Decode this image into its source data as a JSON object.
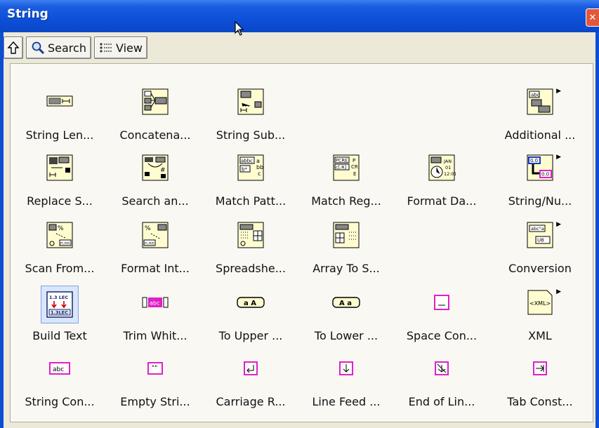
{
  "window": {
    "title": "String",
    "close_glyph": "✕"
  },
  "toolbar": {
    "up_icon": "up-arrow-icon",
    "search_label": "Search",
    "view_label": "View"
  },
  "palette": {
    "items": [
      {
        "label": "String Len...",
        "icon": "string-length-icon",
        "submenu": false
      },
      {
        "label": "Concatena...",
        "icon": "concatenate-icon",
        "submenu": false
      },
      {
        "label": "String Sub...",
        "icon": "string-subset-icon",
        "submenu": false
      },
      {
        "label": "Additional ...",
        "icon": "additional-functions-icon",
        "submenu": true
      },
      {
        "label": "Replace S...",
        "icon": "replace-substring-icon",
        "submenu": false
      },
      {
        "label": "Search an...",
        "icon": "search-and-replace-icon",
        "submenu": false
      },
      {
        "label": "Match Patt...",
        "icon": "match-pattern-icon",
        "submenu": false
      },
      {
        "label": "Match Reg...",
        "icon": "match-regex-icon",
        "submenu": false
      },
      {
        "label": "Format Da...",
        "icon": "format-date-icon",
        "submenu": false
      },
      {
        "label": "String/Nu...",
        "icon": "string-number-icon",
        "submenu": true
      },
      {
        "label": "Scan From...",
        "icon": "scan-from-icon",
        "submenu": false
      },
      {
        "label": "Format Int...",
        "icon": "format-into-icon",
        "submenu": false
      },
      {
        "label": "Spreadshe...",
        "icon": "spreadsheet-icon",
        "submenu": false
      },
      {
        "label": "Array To S...",
        "icon": "array-to-spreadsheet-icon",
        "submenu": false
      },
      {
        "label": "Conversion",
        "icon": "conversion-icon",
        "submenu": true
      },
      {
        "label": "Build Text",
        "icon": "build-text-icon",
        "submenu": false,
        "selected": true
      },
      {
        "label": "Trim Whit...",
        "icon": "trim-whitespace-icon",
        "submenu": false
      },
      {
        "label": "To Upper ...",
        "icon": "to-upper-icon",
        "submenu": false
      },
      {
        "label": "To Lower ...",
        "icon": "to-lower-icon",
        "submenu": false
      },
      {
        "label": "Space Con...",
        "icon": "space-constant-icon",
        "submenu": false
      },
      {
        "label": "XML",
        "icon": "xml-icon",
        "submenu": true
      },
      {
        "label": "String Con...",
        "icon": "string-constant-icon",
        "submenu": false
      },
      {
        "label": "Empty Stri...",
        "icon": "empty-string-icon",
        "submenu": false
      },
      {
        "label": "Carriage R...",
        "icon": "carriage-return-icon",
        "submenu": false
      },
      {
        "label": "Line Feed ...",
        "icon": "line-feed-icon",
        "submenu": false
      },
      {
        "label": "End of Lin...",
        "icon": "end-of-line-icon",
        "submenu": false
      },
      {
        "label": "Tab Const...",
        "icon": "tab-constant-icon",
        "submenu": false
      }
    ]
  },
  "icon_text": {
    "build_text_top": "1.3  LEC",
    "build_text_bottom": "1.3LEC",
    "trim": "abc",
    "upper": "a A",
    "lower": "A a",
    "string_const": "abc",
    "empty": "\"\"",
    "xml": "<XML>",
    "numconv": "0.0"
  },
  "colors": {
    "titlebar": "#0c4ed4",
    "accent_magenta": "#e020c8",
    "icon_bg": "#fffdd0"
  }
}
